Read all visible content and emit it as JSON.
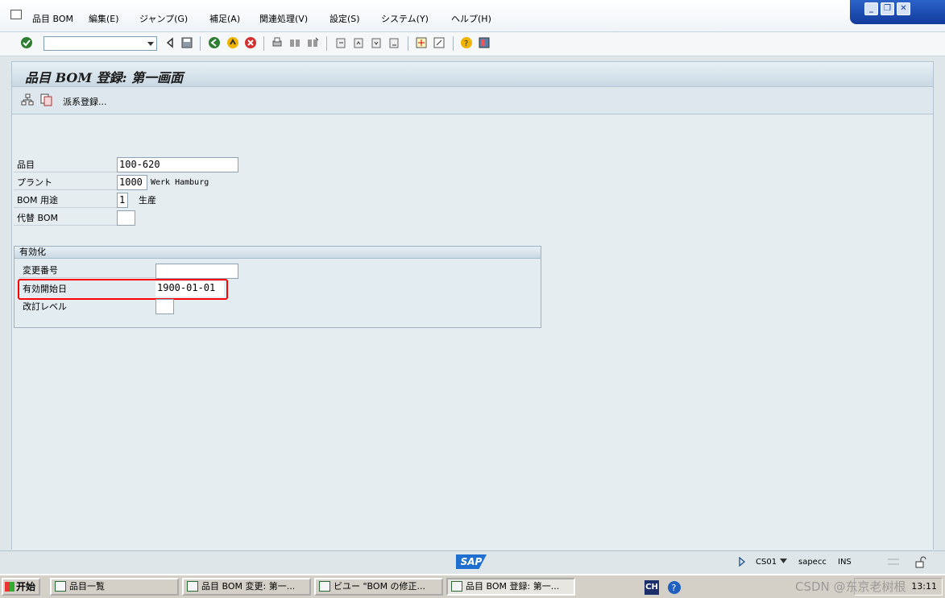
{
  "menu": {
    "items": [
      "品目 BOM",
      "編集(E)",
      "ジャンプ(G)",
      "補足(A)",
      "関連処理(V)",
      "設定(S)",
      "システム(Y)",
      "ヘルプ(H)"
    ]
  },
  "toolbar": {
    "command_field_value": ""
  },
  "title": "品目 BOM 登録: 第一画面",
  "app_toolbar": {
    "dispatch_label": "派系登録..."
  },
  "form": {
    "material_label": "品目",
    "material_value": "100-620",
    "plant_label": "プラント",
    "plant_value": "1000",
    "plant_desc": "Werk Hamburg",
    "bom_usage_label": "BOM 用途",
    "bom_usage_value": "1",
    "bom_usage_desc": "生産",
    "alt_bom_label": "代替 BOM",
    "alt_bom_value": ""
  },
  "validity": {
    "title": "有効化",
    "change_number_label": "変更番号",
    "change_number_value": "",
    "valid_from_label": "有効開始日",
    "valid_from_value": "1900-01-01",
    "revision_label": "改訂レベル",
    "revision_value": ""
  },
  "status": {
    "logo": "SAP",
    "transaction": "CS01",
    "server": "sapecc",
    "mode": "INS"
  },
  "taskbar": {
    "start": "开始",
    "tasks": [
      "品目一覧",
      "品目 BOM 変更: 第一...",
      "ビユー \"BOM の修正...",
      "品目 BOM 登録: 第一..."
    ],
    "lang": "CH",
    "clock": "13:11",
    "watermark": "CSDN @东京老树根"
  },
  "colors": {
    "highlight": "#ff0000",
    "sap_blue": "#1f6fd0"
  }
}
